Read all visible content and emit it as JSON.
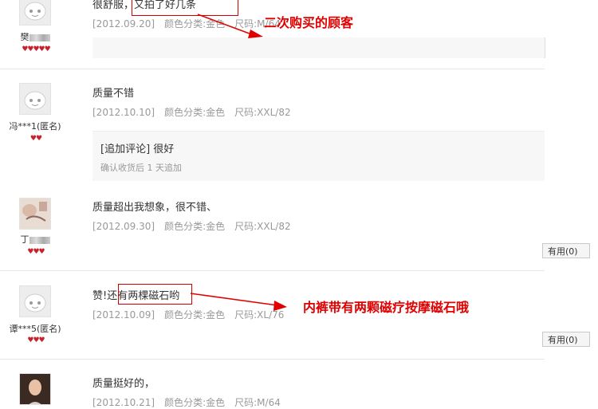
{
  "reviews": [
    {
      "user": "樊",
      "comment": "很舒服，又拍了好几条",
      "date": "[2012.09.20]",
      "color": "颜色分类:金色",
      "size": "尺码:M/64"
    },
    {
      "user": "冯***1(匿名)",
      "comment": "质量不错",
      "date": "[2012.10.10]",
      "color": "颜色分类:金色",
      "size": "尺码:XXL/82",
      "append_text": "[追加评论] 很好",
      "append_note": "确认收货后 1 天追加"
    },
    {
      "user": "丁",
      "comment": "质量超出我想象，很不错、",
      "date": "[2012.09.30]",
      "color": "颜色分类:金色",
      "size": "尺码:XXL/82",
      "useful": "有用(0)"
    },
    {
      "user": "谭***5(匿名)",
      "comment": "赞!还有两棵磁石哟",
      "date": "[2012.10.09]",
      "color": "颜色分类:金色",
      "size": "尺码:XL/76",
      "useful": "有用(0)"
    },
    {
      "comment": "质量挺好的，",
      "date": "[2012.10.21]",
      "color": "颜色分类:金色",
      "size": "尺码:M/64"
    }
  ],
  "annotations": {
    "repeat_buyer": "二次购买的顾客",
    "magnet_note": "内裤带有两颗磁疗按摩磁石哦"
  },
  "colors": {
    "annotation": "#e00000",
    "heart": "#c8202c"
  },
  "icons": {
    "avatar": "default-avatar-icon",
    "heart": "heart-icon"
  }
}
